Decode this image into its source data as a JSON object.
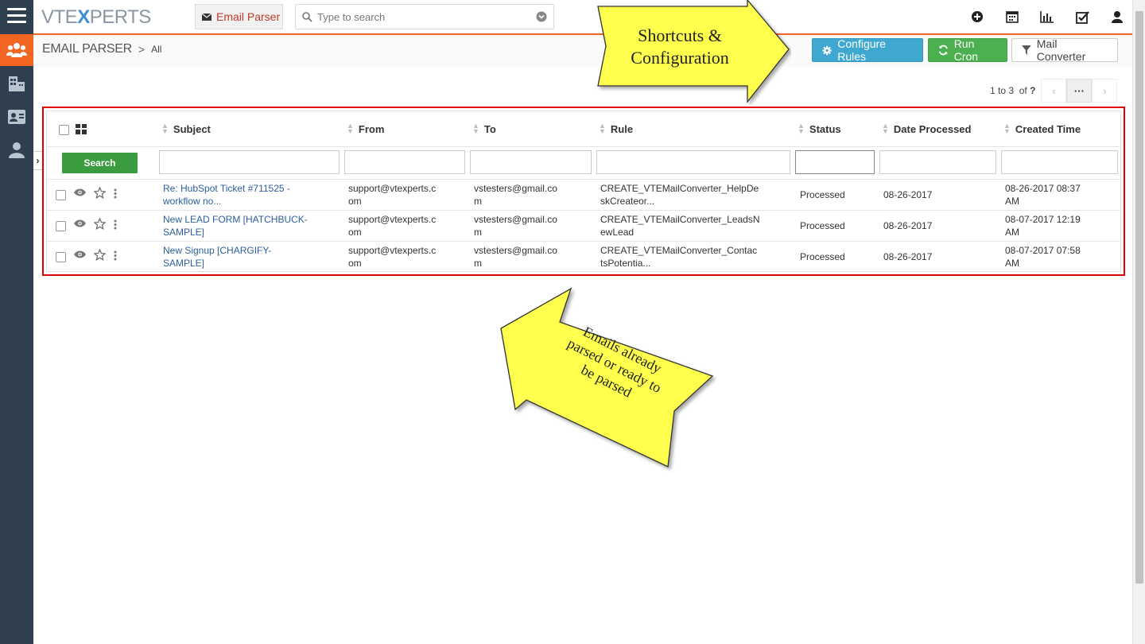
{
  "logo": {
    "part1": "VTE",
    "part2": "X",
    "part3": "PERTS"
  },
  "module_button": {
    "label": "Email Parser",
    "icon": "envelope-icon"
  },
  "search": {
    "placeholder": "Type to search",
    "icon": "search-icon"
  },
  "top_icons": [
    "plus-circle-icon",
    "calendar-icon",
    "bar-chart-icon",
    "checkbox-icon",
    "user-icon"
  ],
  "sidebar": {
    "items": [
      "users-icon",
      "building-icon",
      "contact-card-icon",
      "person-icon"
    ]
  },
  "breadcrumb": {
    "module": "EMAIL PARSER",
    "separator": ">",
    "view": "All"
  },
  "toolbar": {
    "configure_rules": "Configure Rules",
    "run_cron": "Run Cron",
    "mail_converter": "Mail Converter"
  },
  "pager": {
    "range": "1 to 3",
    "of_label": "of",
    "total": "?",
    "more": "···"
  },
  "table": {
    "columns": [
      "Subject",
      "From",
      "To",
      "Rule",
      "Status",
      "Date Processed",
      "Created Time"
    ],
    "search_button": "Search",
    "rows": [
      {
        "subject": [
          "Re: HubSpot Ticket #711525 -",
          "workflow no..."
        ],
        "from": [
          "support@vtexperts.c",
          "om"
        ],
        "to": [
          "vstesters@gmail.co",
          "m"
        ],
        "rule": [
          "CREATE_VTEMailConverter_HelpDe",
          "skCreateor..."
        ],
        "status": "Processed",
        "date_processed": "08-26-2017",
        "created_time": [
          "08-26-2017 08:37",
          "AM"
        ]
      },
      {
        "subject": [
          "New LEAD FORM [HATCHBUCK-",
          "SAMPLE]"
        ],
        "from": [
          "support@vtexperts.c",
          "om"
        ],
        "to": [
          "vstesters@gmail.co",
          "m"
        ],
        "rule": [
          "CREATE_VTEMailConverter_LeadsN",
          "ewLead"
        ],
        "status": "Processed",
        "date_processed": "08-26-2017",
        "created_time": [
          "08-07-2017 12:19",
          "AM"
        ]
      },
      {
        "subject": [
          "New Signup [CHARGIFY-",
          "SAMPLE]"
        ],
        "from": [
          "support@vtexperts.c",
          "om"
        ],
        "to": [
          "vstesters@gmail.co",
          "m"
        ],
        "rule": [
          "CREATE_VTEMailConverter_Contac",
          "tsPotentia..."
        ],
        "status": "Processed",
        "date_processed": "08-26-2017",
        "created_time": [
          "08-07-2017 07:58",
          "AM"
        ]
      }
    ]
  },
  "annotations": {
    "shortcuts": [
      "Shortcuts &",
      "Configuration"
    ],
    "emails": [
      "Emails already",
      "parsed or ready to",
      "be parsed"
    ]
  },
  "colors": {
    "accent": "#f26522",
    "rail": "#2f3f4f",
    "configure": "#3fa8d1",
    "cron": "#4cb050",
    "callout": "#ffff4d",
    "highlight": "#e00000"
  }
}
